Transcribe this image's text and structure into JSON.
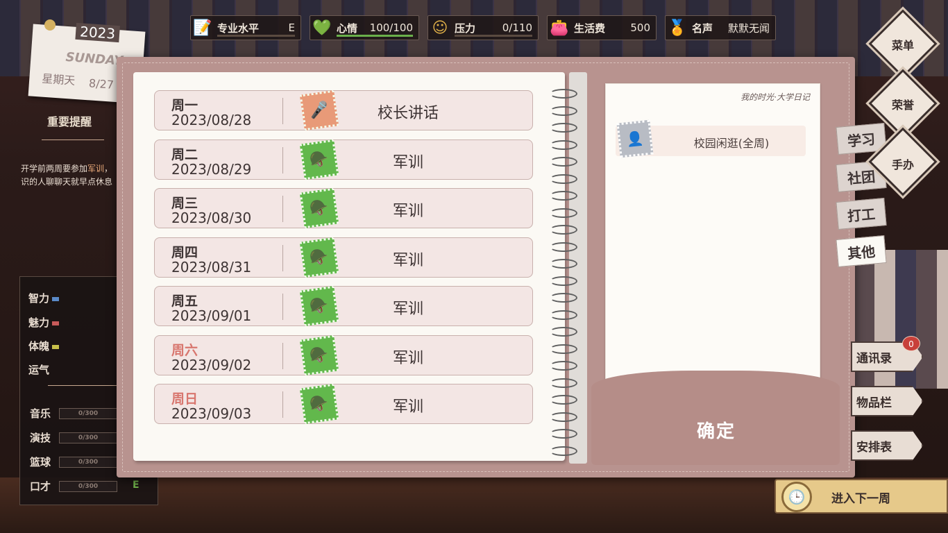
{
  "stats": [
    {
      "icon": "notebook-icon",
      "glyph": "📝",
      "label": "专业水平",
      "value": "E"
    },
    {
      "icon": "heart-icon",
      "glyph": "💚",
      "label": "心情",
      "value": "100/100",
      "fill": 1.0
    },
    {
      "icon": "smile-icon",
      "glyph": "☺",
      "label": "压力",
      "value": "0/110",
      "fill": 0.0
    },
    {
      "icon": "wallet-icon",
      "glyph": "👛",
      "label": "生活费",
      "value": "500"
    },
    {
      "icon": "medal-icon",
      "glyph": "🏅",
      "label": "名声",
      "value": "默默无闻"
    }
  ],
  "calendar": {
    "year": "2023",
    "day": "SUNDAY",
    "weekday": "星期天",
    "date": "8/27"
  },
  "reminder": {
    "title": "重要提醒",
    "text_before": "开学前两周要参加",
    "highlight": "军训",
    "text_after": "，",
    "line2": "识的人聊聊天就早点休息"
  },
  "attributes": [
    {
      "label": "智力",
      "color": "#5a8ac8"
    },
    {
      "label": "魅力",
      "color": "#c85a5a"
    },
    {
      "label": "体魄",
      "color": "#c8c04a"
    },
    {
      "label": "运气",
      "color": ""
    }
  ],
  "skills": [
    {
      "label": "音乐",
      "value": "0/300"
    },
    {
      "label": "演技",
      "value": "0/300"
    },
    {
      "label": "篮球",
      "value": "0/300"
    },
    {
      "label": "口才",
      "value": "0/300"
    }
  ],
  "skill_grade": "E",
  "schedule": [
    {
      "weekday": "周一",
      "date": "2023/08/28",
      "activity": "校长讲话",
      "stamp": "orange",
      "weekend": false
    },
    {
      "weekday": "周二",
      "date": "2023/08/29",
      "activity": "军训",
      "stamp": "green",
      "weekend": false
    },
    {
      "weekday": "周三",
      "date": "2023/08/30",
      "activity": "军训",
      "stamp": "green",
      "weekend": false
    },
    {
      "weekday": "周四",
      "date": "2023/08/31",
      "activity": "军训",
      "stamp": "green",
      "weekend": false
    },
    {
      "weekday": "周五",
      "date": "2023/09/01",
      "activity": "军训",
      "stamp": "green",
      "weekend": false
    },
    {
      "weekday": "周六",
      "date": "2023/09/02",
      "activity": "军训",
      "stamp": "green",
      "weekend": true
    },
    {
      "weekday": "周日",
      "date": "2023/09/03",
      "activity": "军训",
      "stamp": "green",
      "weekend": true
    }
  ],
  "options": {
    "logo": "我的时光·大学日记",
    "item": "校园闲逛(全周)",
    "confirm": "确定"
  },
  "tabs": [
    "学习",
    "社团",
    "打工",
    "其他"
  ],
  "active_tab": "其他",
  "nav": {
    "menu": "菜单",
    "honor": "荣誉",
    "figure": "手办"
  },
  "side": {
    "contacts": "通讯录",
    "inventory": "物品栏",
    "schedule": "安排表",
    "contacts_badge": "0"
  },
  "next_week": "进入下一周"
}
